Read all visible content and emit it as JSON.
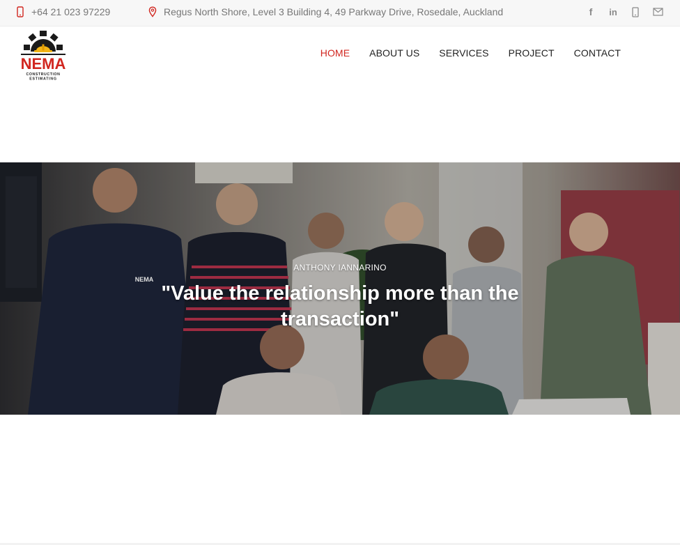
{
  "topbar": {
    "phone": "+64 21 023 97229",
    "address": "Regus North Shore, Level 3 Building 4, 49 Parkway Drive, Rosedale, Auckland",
    "accent_color": "#d1261f",
    "socials": [
      {
        "name": "facebook-icon",
        "glyph": "f"
      },
      {
        "name": "linkedin-icon",
        "glyph": "in"
      },
      {
        "name": "mobile-icon",
        "glyph": ""
      },
      {
        "name": "mail-icon",
        "glyph": ""
      }
    ]
  },
  "brand": {
    "name": "NEMA",
    "line1": "CONSTRUCTION",
    "line2": "ESTIMATING",
    "colors": {
      "red": "#d1261f",
      "yellow": "#f2b417",
      "dark": "#1a1a1a"
    }
  },
  "nav": {
    "items": [
      {
        "label": "HOME",
        "active": true
      },
      {
        "label": "ABOUT US",
        "active": false
      },
      {
        "label": "SERVICES",
        "active": false
      },
      {
        "label": "PROJECT",
        "active": false
      },
      {
        "label": "CONTACT",
        "active": false
      }
    ]
  },
  "hero": {
    "author": "ANTHONY IANNARINO",
    "quote": "\"Value the relationship more than the transaction\"",
    "shirt_logo": "NEMA"
  }
}
